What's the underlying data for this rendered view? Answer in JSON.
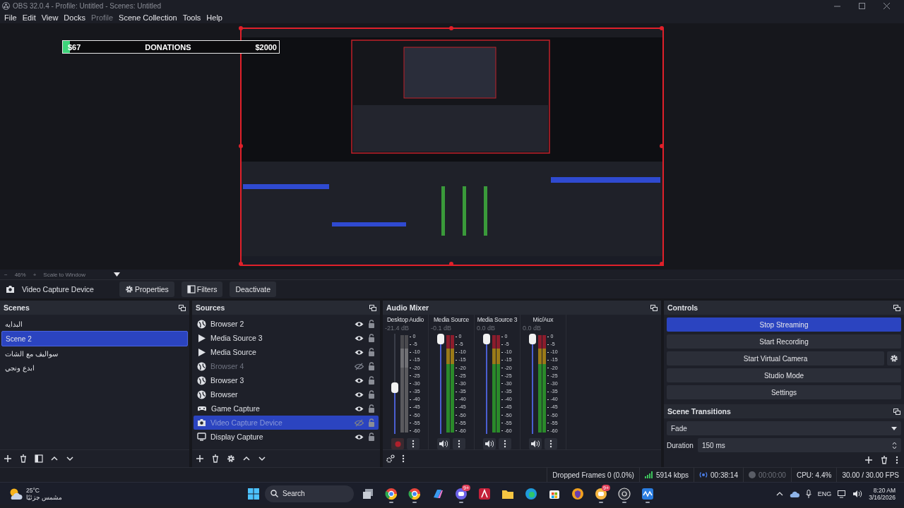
{
  "window": {
    "title": "OBS 32.0.4 - Profile: Untitled - Scenes: Untitled"
  },
  "menu": [
    {
      "label": "File",
      "disabled": false
    },
    {
      "label": "Edit",
      "disabled": false
    },
    {
      "label": "View",
      "disabled": false
    },
    {
      "label": "Docks",
      "disabled": false
    },
    {
      "label": "Profile",
      "disabled": true
    },
    {
      "label": "Scene Collection",
      "disabled": false
    },
    {
      "label": "Tools",
      "disabled": false
    },
    {
      "label": "Help",
      "disabled": false
    }
  ],
  "preview": {
    "selected": true,
    "overlay": {
      "left": "$67",
      "center": "DONATIONS",
      "right": "$2000",
      "level": 0.034
    }
  },
  "zoom_bar": {
    "minus": "−",
    "zoom": "46%",
    "plus": "+",
    "mode": "Scale to Window"
  },
  "context_bar": {
    "source": "Video Capture Device",
    "buttons": [
      {
        "label": "Properties",
        "kind": "gear"
      },
      {
        "label": "Filters",
        "kind": "filter"
      },
      {
        "label": "Deactivate",
        "kind": "plain"
      }
    ]
  },
  "scenes": {
    "title": "Scenes",
    "items": [
      {
        "name": "البدايه",
        "selected": false
      },
      {
        "name": "Scene 2",
        "selected": true
      },
      {
        "name": "سواليف مع الشات",
        "selected": false
      },
      {
        "name": "ابدع ونجي",
        "selected": false
      }
    ]
  },
  "sources": {
    "title": "Sources",
    "items": [
      {
        "name": "Browser 2",
        "kind": "browser",
        "visible": true,
        "selected": false
      },
      {
        "name": "Media Source 3",
        "kind": "media",
        "visible": true,
        "selected": false
      },
      {
        "name": "Media Source",
        "kind": "media",
        "visible": true,
        "selected": false
      },
      {
        "name": "Browser 4",
        "kind": "browser",
        "visible": false,
        "selected": false
      },
      {
        "name": "Browser 3",
        "kind": "browser",
        "visible": true,
        "selected": false
      },
      {
        "name": "Browser",
        "kind": "browser",
        "visible": true,
        "selected": false
      },
      {
        "name": "Game Capture",
        "kind": "game",
        "visible": true,
        "selected": false
      },
      {
        "name": "Video Capture Device",
        "kind": "camera",
        "visible": false,
        "selected": true
      },
      {
        "name": "Display Capture",
        "kind": "display",
        "visible": true,
        "selected": false
      }
    ]
  },
  "audio_mixer": {
    "title": "Audio Mixer",
    "channels": [
      {
        "name": "Desktop Audio",
        "reading": "-21.4 dB",
        "level": 0.46,
        "muted": true,
        "scale": [
          "0",
          "-5",
          "-10",
          "-15",
          "-20",
          "-25",
          "-30",
          "-35",
          "-40",
          "-45",
          "-50",
          "-55",
          "-60"
        ]
      },
      {
        "name": "Media Source",
        "reading": "-0.1 dB",
        "level": 1,
        "muted": false,
        "scale": [
          "0",
          "-5",
          "-10",
          "-15",
          "-20",
          "-25",
          "-30",
          "-35",
          "-40",
          "-45",
          "-50",
          "-55",
          "-60"
        ]
      },
      {
        "name": "Media Source 3",
        "reading": "0.0 dB",
        "level": 1,
        "muted": false,
        "scale": [
          "0",
          "-5",
          "-10",
          "-15",
          "-20",
          "-25",
          "-30",
          "-35",
          "-40",
          "-45",
          "-50",
          "-55",
          "-60"
        ]
      },
      {
        "name": "Mic/Aux",
        "reading": "0.0 dB",
        "level": 1,
        "muted": false,
        "scale": [
          "0",
          "-5",
          "-10",
          "-15",
          "-20",
          "-25",
          "-30",
          "-35",
          "-40",
          "-45",
          "-50",
          "-55",
          "-60"
        ]
      }
    ]
  },
  "controls": {
    "title": "Controls",
    "buttons": [
      {
        "label": "Stop Streaming",
        "active": true,
        "has_settings": false
      },
      {
        "label": "Start Recording",
        "active": false,
        "has_settings": false
      },
      {
        "label": "Start Virtual Camera",
        "active": false,
        "has_settings": true
      },
      {
        "label": "Studio Mode",
        "active": false,
        "has_settings": false
      },
      {
        "label": "Settings",
        "active": false,
        "has_settings": false
      }
    ]
  },
  "scene_transitions": {
    "title": "Scene Transitions",
    "transition": "Fade",
    "duration_label": "Duration",
    "duration": "150 ms"
  },
  "status_bar": {
    "dropped_frames": "Dropped Frames 0 (0.0%)",
    "bitrate": "5914 kbps",
    "stream_time": "00:38:14",
    "record_time": "00:00:00",
    "cpu": "CPU: 4.4%",
    "fps": "30.00 / 30.00 FPS"
  },
  "taskbar": {
    "weather": {
      "temperature": "25°C",
      "condition": "مشمس جزئيًا"
    },
    "search": "Search",
    "apps": [
      {
        "kind": "taskview",
        "open": false
      },
      {
        "kind": "browser",
        "open": true
      },
      {
        "kind": "browser",
        "open": true
      },
      {
        "kind": "assistant",
        "open": false
      },
      {
        "kind": "chat",
        "open": true,
        "badge": "9+"
      },
      {
        "kind": "letter",
        "open": false
      },
      {
        "kind": "folder",
        "open": false
      },
      {
        "kind": "edge",
        "open": false
      },
      {
        "kind": "store",
        "open": false
      },
      {
        "kind": "shield",
        "open": false
      },
      {
        "kind": "chat-yellow",
        "open": true,
        "badge": "9+"
      },
      {
        "kind": "recorder",
        "open": true
      },
      {
        "kind": "wave",
        "open": true
      }
    ],
    "tray": {
      "language": "ENG",
      "time": "8:20 AM",
      "date": "3/16/2026"
    }
  }
}
